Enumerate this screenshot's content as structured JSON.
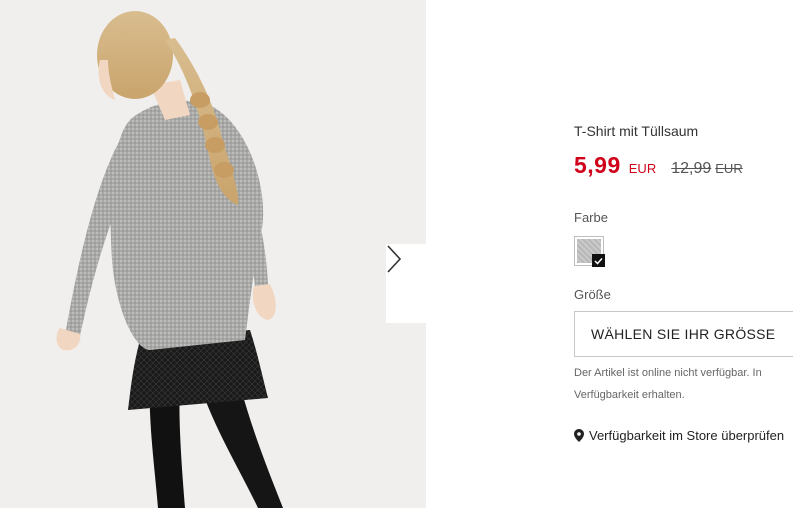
{
  "product": {
    "title": "T-Shirt mit Tüllsaum",
    "sale_price": "5,99",
    "sale_currency": "EUR",
    "original_price": "12,99",
    "original_currency": "EUR"
  },
  "color": {
    "label": "Farbe",
    "selected_swatch": "grey-melange-check",
    "swatch_color": "#c0c0c0"
  },
  "size": {
    "label": "Größe",
    "button_label": "WÄHLEN SIE IHR GRÖSSE"
  },
  "availability": {
    "note_line1": "Der Artikel ist online nicht verfügbar. In",
    "note_line2": "Verfügbarkeit erhalten.",
    "store_link": "Verfügbarkeit im Store überprüfen",
    "store_icon": "location-pin-icon"
  },
  "gallery": {
    "next_icon": "chevron-right-icon"
  },
  "colors": {
    "sale_red": "#d0021b",
    "text_dark": "#333333",
    "background_gray": "#f0efed"
  }
}
